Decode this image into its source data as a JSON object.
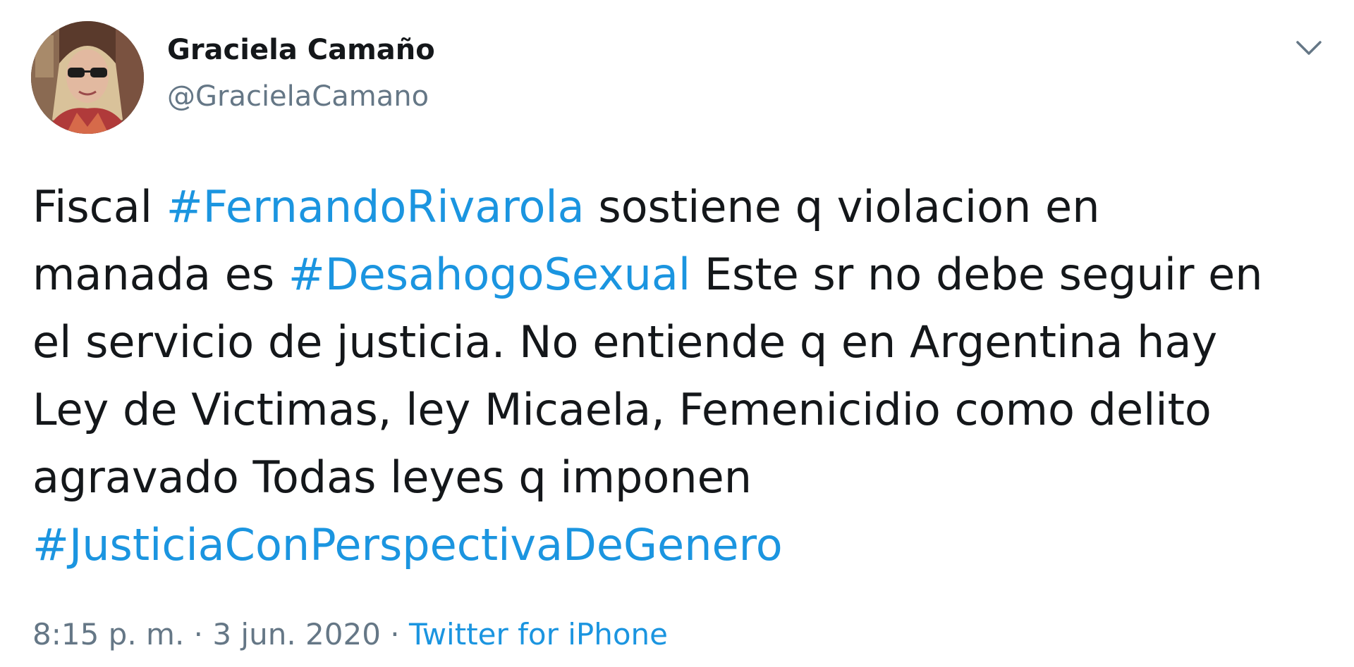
{
  "author": {
    "name": "Graciela Camaño",
    "handle": "@GracielaCamano",
    "avatar_icon": "profile-photo"
  },
  "menu": {
    "icon": "chevron-down-icon"
  },
  "tweet": {
    "lines": [
      [
        {
          "text": "Fiscal ",
          "hashtag": false
        },
        {
          "text": "#FernandoRivarola",
          "hashtag": true
        },
        {
          "text": " sostiene q violacion en",
          "hashtag": false
        }
      ],
      [
        {
          "text": "manada es ",
          "hashtag": false
        },
        {
          "text": "#DesahogoSexual",
          "hashtag": true
        },
        {
          "text": " Este sr no debe seguir en",
          "hashtag": false
        }
      ],
      [
        {
          "text": "el servicio de justicia. No entiende q en Argentina hay",
          "hashtag": false
        }
      ],
      [
        {
          "text": "Ley de Victimas, ley Micaela, Femenicidio como delito",
          "hashtag": false
        }
      ],
      [
        {
          "text": "agravado Todas leyes q imponen",
          "hashtag": false
        }
      ],
      [
        {
          "text": "#JusticiaConPerspectivaDeGenero",
          "hashtag": true
        }
      ]
    ]
  },
  "meta": {
    "time": "8:15 p. m.",
    "separator": " · ",
    "date": "3 jun. 2020",
    "source": "Twitter for iPhone"
  },
  "colors": {
    "text": "#14171a",
    "secondary": "#657786",
    "link": "#1b95e0",
    "background": "#ffffff"
  }
}
